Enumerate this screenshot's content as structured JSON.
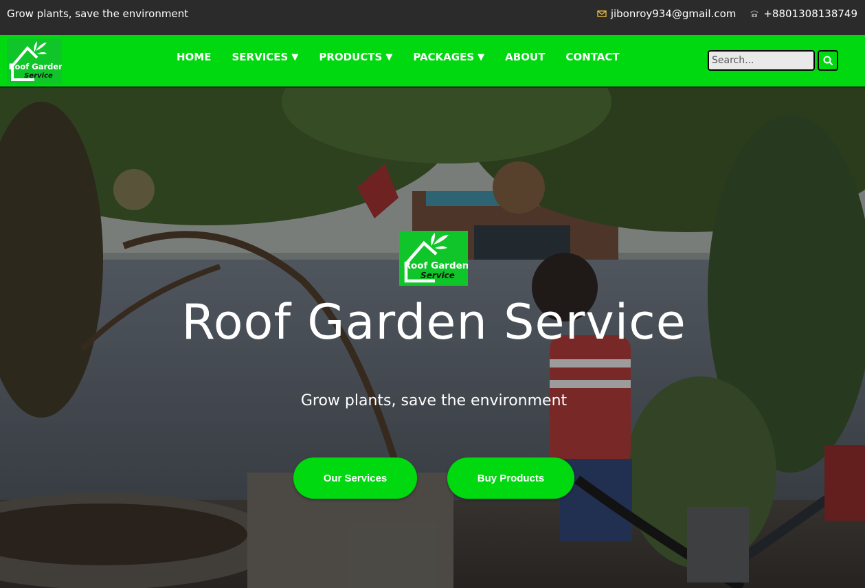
{
  "topbar": {
    "tagline": "Grow plants, save the environment",
    "email": "jibonroy934@gmail.com",
    "phone": "+8801308138749"
  },
  "logo": {
    "line1": "Roof Garden",
    "line2": "Service"
  },
  "nav": {
    "items": [
      {
        "label": "HOME",
        "dropdown": false
      },
      {
        "label": "SERVICES",
        "dropdown": true
      },
      {
        "label": "PRODUCTS",
        "dropdown": true
      },
      {
        "label": "PACKAGES",
        "dropdown": true
      },
      {
        "label": "ABOUT",
        "dropdown": false
      },
      {
        "label": "CONTACT",
        "dropdown": false
      }
    ],
    "caret": "▼",
    "search_placeholder": "Search..."
  },
  "hero": {
    "title": "Roof Garden Service",
    "subtitle": "Grow plants, save the environment",
    "buttons": {
      "services": "Our Services",
      "products": "Buy Products"
    }
  },
  "colors": {
    "brand_green": "#00d80f",
    "topbar_bg": "#2b2b2b",
    "accent_icon": "#f0c040"
  },
  "icons": [
    "mail-icon",
    "phone-icon",
    "search-icon",
    "house-leaf-icon"
  ]
}
